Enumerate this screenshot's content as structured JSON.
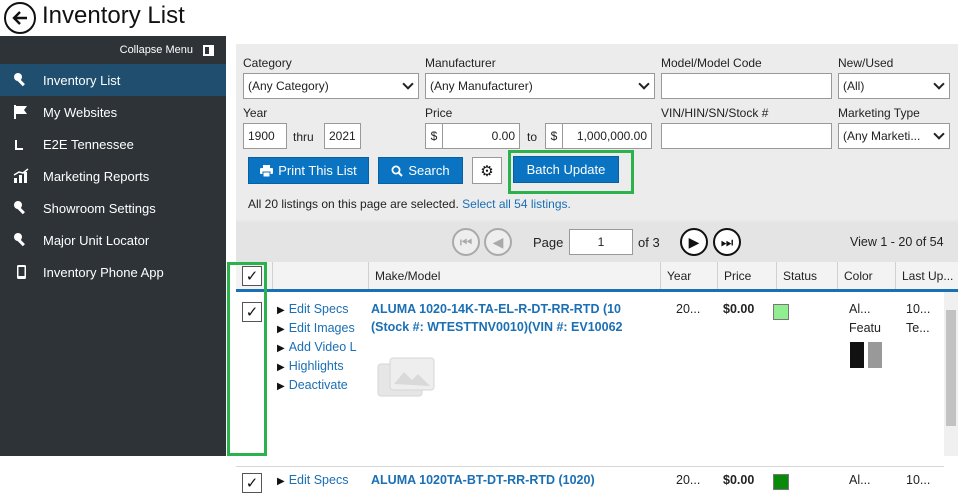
{
  "header": {
    "title": "Inventory List"
  },
  "sidebar": {
    "collapse_label": "Collapse Menu",
    "items": [
      {
        "label": "Inventory List",
        "icon": "key-icon"
      },
      {
        "label": "My Websites",
        "icon": "flag-icon"
      },
      {
        "label": "E2E Tennessee",
        "icon": "chart-icon"
      },
      {
        "label": "Marketing Reports",
        "icon": "bar-chart-icon"
      },
      {
        "label": "Showroom Settings",
        "icon": "key-icon"
      },
      {
        "label": "Major Unit Locator",
        "icon": "key-icon"
      },
      {
        "label": "Inventory Phone App",
        "icon": "phone-icon"
      }
    ]
  },
  "filters": {
    "category_label": "Category",
    "category_value": "(Any Category)",
    "manufacturer_label": "Manufacturer",
    "manufacturer_value": "(Any Manufacturer)",
    "model_label": "Model/Model Code",
    "model_value": "",
    "newused_label": "New/Used",
    "newused_value": "(All)",
    "year_label": "Year",
    "year_from": "1900",
    "year_thru_label": "thru",
    "year_to": "2021",
    "price_label": "Price",
    "price_currency": "$",
    "price_from": "0.00",
    "price_to_label": "to",
    "price_to": "1,000,000.00",
    "vin_label": "VIN/HIN/SN/Stock #",
    "vin_value": "",
    "marketing_label": "Marketing Type",
    "marketing_value": "(Any Marketi..."
  },
  "actions": {
    "print_label": "Print This List",
    "search_label": "Search",
    "batch_label": "Batch Update"
  },
  "selection": {
    "text": "All 20 listings on this page are selected.",
    "link": "Select all 54 listings."
  },
  "pager": {
    "page_label": "Page",
    "page_value": "1",
    "of_label": "of 3",
    "view_label": "View 1 - 20 of 54"
  },
  "table": {
    "columns": [
      "Make/Model",
      "Year",
      "Price",
      "Status",
      "Color",
      "Last Up..."
    ],
    "rows": [
      {
        "links": [
          "Edit Specs",
          "Edit Images",
          "Add Video L",
          "Highlights",
          "Deactivate"
        ],
        "make_model": "ALUMA 1020-14K-TA-EL-R-DT-RR-RTD (10",
        "stock": "(Stock #: WTESTTNV0010)(VIN #: EV10062",
        "year": "20...",
        "price": "$0.00",
        "status_color": "#90ee90",
        "color": "Al...",
        "color_feature": "Featu",
        "last1": "10...",
        "last2": "Te..."
      },
      {
        "links": [
          "Edit Specs"
        ],
        "make_model": "ALUMA 1020TA-BT-DT-RR-RTD (1020)",
        "year": "20...",
        "price": "$0.00",
        "status_color": "#0a8a0a",
        "color": "Al...",
        "last1": "10..."
      }
    ]
  }
}
